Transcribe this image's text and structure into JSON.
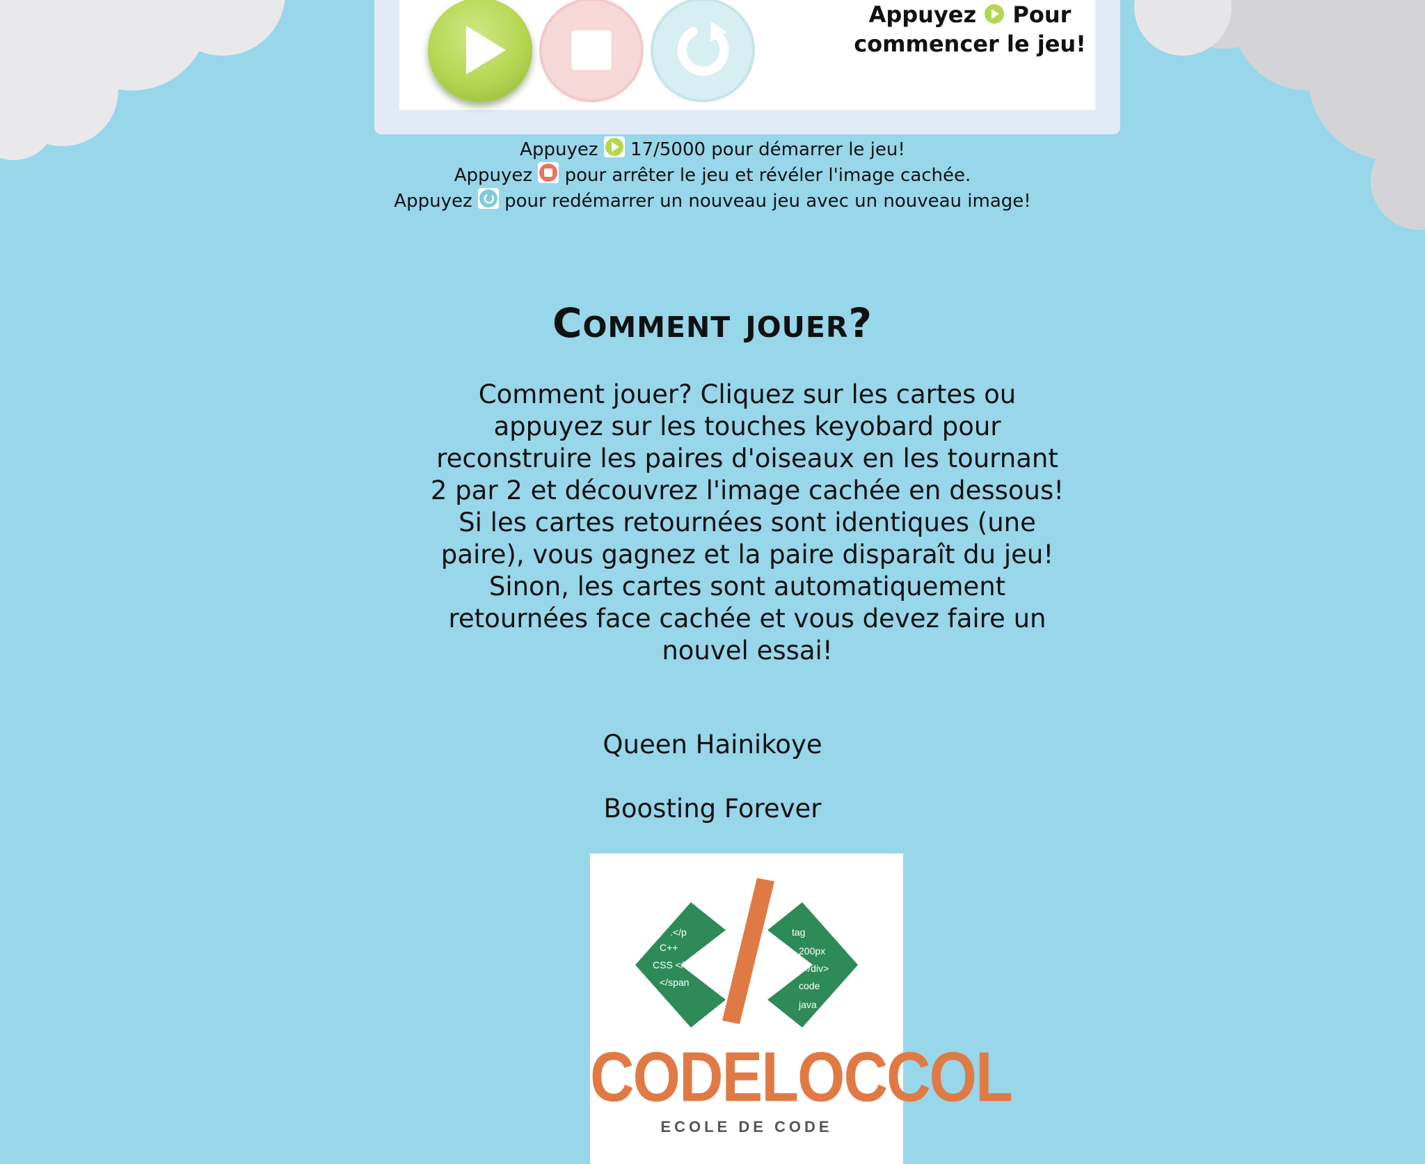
{
  "game_panel": {
    "start_prompt_before": "Appuyez",
    "start_prompt_after": "Pour commencer le jeu!"
  },
  "instructions": {
    "line1_prefix": "Appuyez",
    "line1_suffix": "17/5000 pour démarrer le jeu!",
    "line2_prefix": "Appuyez",
    "line2_suffix": "pour arrêter le jeu et révéler l'image cachée.",
    "line3_prefix": "Appuyez",
    "line3_suffix": "pour redémarrer un nouveau jeu avec un nouveau image!"
  },
  "howto": {
    "title": "Comment jouer?",
    "text": "Comment jouer? Cliquez sur les cartes ou appuyez sur les touches keyobard pour reconstruire les paires d'oiseaux en les tournant 2 par 2 et découvrez l'image cachée en dessous! Si les cartes retournées sont identiques (une paire), vous gagnez et la paire disparaît du jeu! Sinon, les cartes sont automatiquement retournées face cachée et vous devez faire un nouvel essai!"
  },
  "credits": {
    "author": "Queen Hainikoye",
    "tagline": "Boosting Forever"
  },
  "logo": {
    "name": "CODELOCCOL",
    "subtitle": "ECOLE DE CODE"
  },
  "colors": {
    "background": "#98d6ea",
    "play": "#b5d651",
    "stop": "#e8735f",
    "reset": "#7fcbd8",
    "logo_orange": "#e07a45",
    "logo_green": "#2e8b57"
  },
  "icons": [
    "play-icon",
    "stop-icon",
    "reset-icon",
    "cloud"
  ]
}
